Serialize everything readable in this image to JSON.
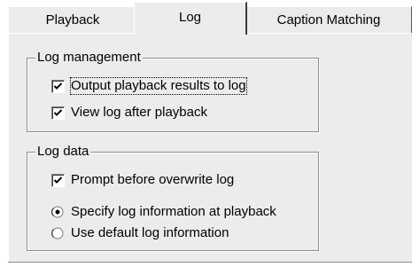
{
  "tabs": [
    {
      "label": "Playback",
      "selected": false
    },
    {
      "label": "Log",
      "selected": true
    },
    {
      "label": "Caption Matching",
      "selected": false
    }
  ],
  "log_management": {
    "title": "Log management",
    "output_results": {
      "label": "Output playback results to log",
      "checked": true
    },
    "view_log": {
      "label": "View log after playback",
      "checked": true
    }
  },
  "log_data": {
    "title": "Log data",
    "prompt_overwrite": {
      "label": "Prompt before overwrite log",
      "checked": true
    },
    "specify_info": {
      "label": "Specify log information at playback",
      "selected": true
    },
    "default_info": {
      "label": "Use default log information",
      "selected": false
    }
  },
  "icons": {
    "checkmark": "checkmark-icon",
    "radio_selected": "radio-selected-icon",
    "radio_unselected": "radio-unselected-icon"
  }
}
